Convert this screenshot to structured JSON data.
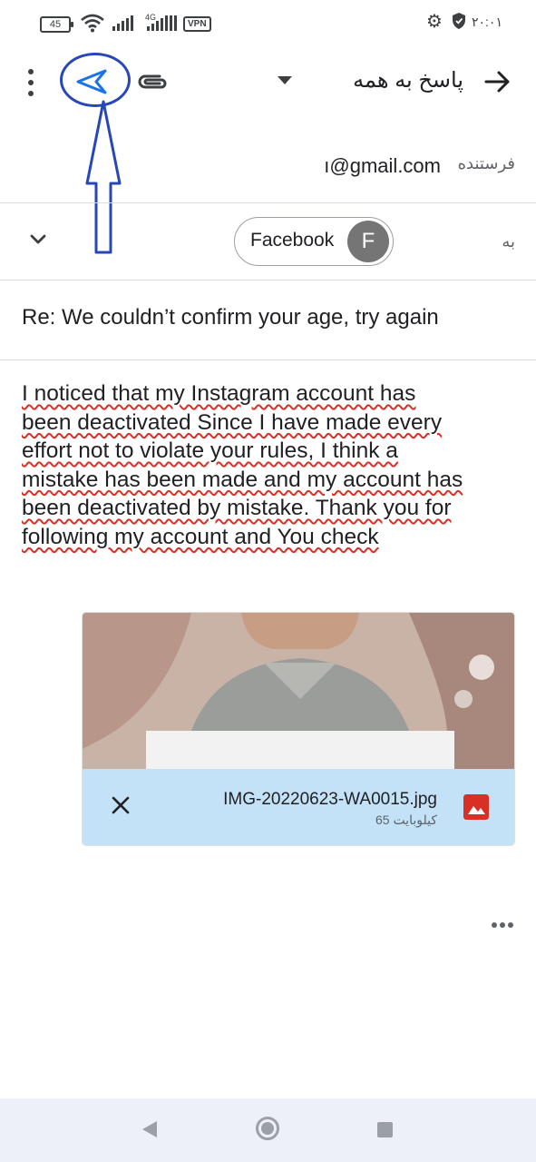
{
  "status_bar": {
    "battery": "45",
    "network": "4G",
    "vpn": "VPN",
    "time": "۲۰:۰۱",
    "icons": [
      "wifi-icon",
      "signal-icon",
      "gear-icon",
      "shield-icon"
    ]
  },
  "toolbar": {
    "reply_all_label": "پاسخ به همه",
    "icons": [
      "more-vert-icon",
      "send-icon",
      "attach-icon",
      "dropdown-icon",
      "back-arrow-icon"
    ],
    "annotation_color": "#2747b8"
  },
  "sender": {
    "label": "فرستنده",
    "email": "ı@gmail.com"
  },
  "recipient": {
    "label": "به",
    "chip_name": "Facebook",
    "avatar_initial": "F"
  },
  "subject": "Re: We couldn’t confirm your age, try again",
  "body": {
    "lines": [
      "I noticed that my Instagram account has",
      "been deactivated Since I have made every",
      "effort not to violate your rules, I think a",
      "mistake has been made and my account has",
      "been deactivated by mistake. Thank you for",
      "following my account and You check"
    ]
  },
  "attachment": {
    "filename": "IMG-20220623-WA0015.jpg",
    "size": "65 کیلوبایت",
    "icons": [
      "close-icon",
      "image-icon"
    ],
    "bar_color": "#c3e2f7",
    "icon_color": "#d93025"
  },
  "colors": {
    "spellcheck_underline": "#d93025",
    "nav_bar": "#eef0f8"
  }
}
